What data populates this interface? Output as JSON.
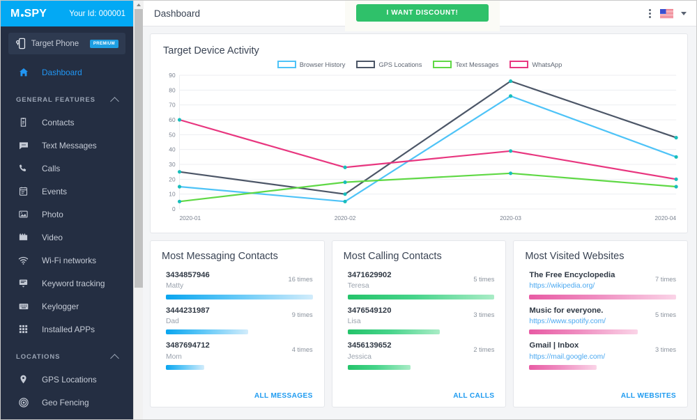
{
  "brand": {
    "logo_m": "M",
    "logo_text": "SPY",
    "user_id": "Your Id: 000001"
  },
  "sidebar": {
    "target_phone": {
      "label": "Target Phone",
      "badge": "PREMIUM",
      "icon": "phone-settings-icon"
    },
    "dashboard": {
      "label": "Dashboard",
      "icon": "home-icon"
    },
    "sections": [
      {
        "title": "GENERAL FEATURES",
        "items": [
          {
            "label": "Contacts",
            "icon": "contacts-icon"
          },
          {
            "label": "Text Messages",
            "icon": "message-icon"
          },
          {
            "label": "Calls",
            "icon": "phone-icon"
          },
          {
            "label": "Events",
            "icon": "calendar-icon"
          },
          {
            "label": "Photo",
            "icon": "photo-icon"
          },
          {
            "label": "Video",
            "icon": "video-icon"
          },
          {
            "label": "Wi-Fi networks",
            "icon": "wifi-icon"
          },
          {
            "label": "Keyword tracking",
            "icon": "keyword-icon"
          },
          {
            "label": "Keylogger",
            "icon": "keyboard-icon"
          },
          {
            "label": "Installed APPs",
            "icon": "apps-grid-icon"
          }
        ]
      },
      {
        "title": "LOCATIONS",
        "items": [
          {
            "label": "GPS Locations",
            "icon": "map-pin-icon"
          },
          {
            "label": "Geo Fencing",
            "icon": "target-circle-icon"
          }
        ]
      }
    ]
  },
  "topbar": {
    "title": "Dashboard",
    "discount_label": "I WANT DISCOUNT!",
    "kebab_icon": "more-vertical-icon",
    "flag_icon": "us-flag-icon",
    "caret_icon": "chevron-down-icon"
  },
  "chart_data": {
    "type": "line",
    "title": "Target Device Activity",
    "categories": [
      "2020-01",
      "2020-02",
      "2020-03",
      "2020-04"
    ],
    "xlabel": "",
    "ylabel": "",
    "ylim": [
      0,
      90
    ],
    "yticks": [
      0,
      10,
      20,
      30,
      40,
      50,
      60,
      70,
      80,
      90
    ],
    "grid": true,
    "legend_position": "top-center",
    "point_marker_color": "#17bebb",
    "series": [
      {
        "name": "Browser History",
        "color": "#4ec3f7",
        "values": [
          15,
          5,
          76,
          35
        ]
      },
      {
        "name": "GPS Locations",
        "color": "#4c5667",
        "values": [
          25,
          10,
          86,
          48
        ]
      },
      {
        "name": "Text Messages",
        "color": "#5fd845",
        "values": [
          5,
          18,
          24,
          15
        ]
      },
      {
        "name": "WhatsApp",
        "color": "#e8367f",
        "values": [
          60,
          28,
          39,
          20
        ]
      }
    ]
  },
  "cards": [
    {
      "title": "Most Messaging Contacts",
      "bar_style": "blue",
      "footer": "ALL MESSAGES",
      "entries": [
        {
          "title": "3434857946",
          "sub": "Matty",
          "sub_is_link": false,
          "count": "16 times",
          "pct": 100
        },
        {
          "title": "3444231987",
          "sub": "Dad",
          "sub_is_link": false,
          "count": "9 times",
          "pct": 56
        },
        {
          "title": "3487694712",
          "sub": "Mom",
          "sub_is_link": false,
          "count": "4 times",
          "pct": 26
        }
      ]
    },
    {
      "title": "Most Calling Contacts",
      "bar_style": "green",
      "footer": "ALL CALLS",
      "entries": [
        {
          "title": "3471629902",
          "sub": "Teresa",
          "sub_is_link": false,
          "count": "5 times",
          "pct": 100
        },
        {
          "title": "3476549120",
          "sub": "Lisa",
          "sub_is_link": false,
          "count": "3 times",
          "pct": 63
        },
        {
          "title": "3456139652",
          "sub": "Jessica",
          "sub_is_link": false,
          "count": "2 times",
          "pct": 43
        }
      ]
    },
    {
      "title": "Most Visited Websites",
      "bar_style": "pink",
      "footer": "ALL WEBSITES",
      "entries": [
        {
          "title": "The Free Encyclopedia",
          "sub": "https://wikipedia.org/",
          "sub_is_link": true,
          "count": "7 times",
          "pct": 100
        },
        {
          "title": "Music for everyone.",
          "sub": "https://www.spotify.com/",
          "sub_is_link": true,
          "count": "5 times",
          "pct": 74
        },
        {
          "title": "Gmail | Inbox",
          "sub": "https://mail.google.com/",
          "sub_is_link": true,
          "count": "3 times",
          "pct": 46
        }
      ]
    }
  ],
  "colors": {
    "brand_blue": "#03a9f4",
    "sidebar_bg": "#242e42",
    "accent_link": "#1f9bf0",
    "discount_green": "#2fc16a"
  }
}
